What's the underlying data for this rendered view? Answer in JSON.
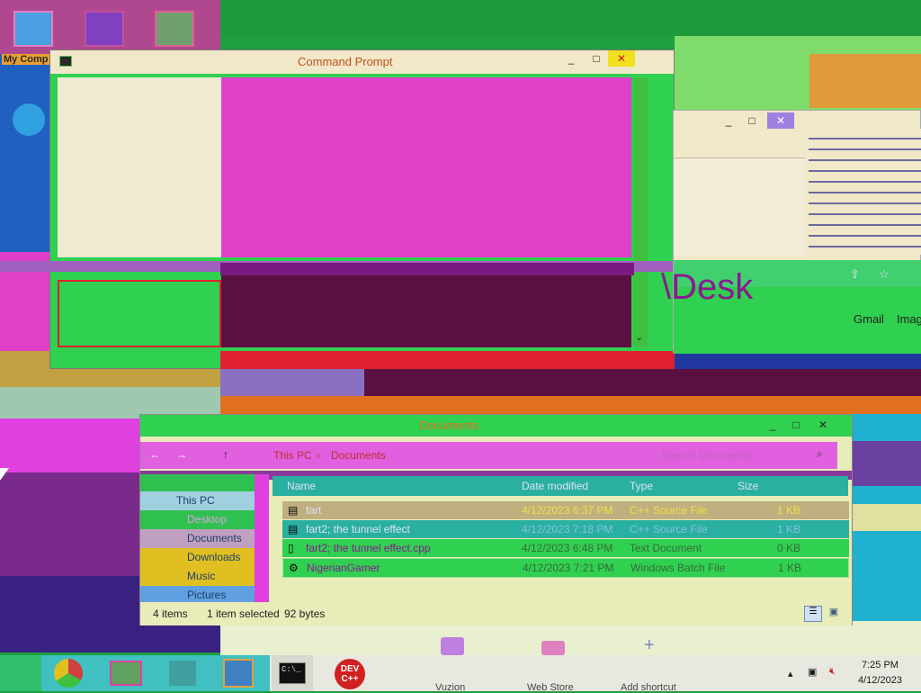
{
  "desktop": {
    "icon_label_partial": "My Comp",
    "path_fragment": "\\Desk",
    "gmail_link": "Gmail",
    "images_link": "Imag",
    "shortcuts": [
      {
        "label": "Vuzion"
      },
      {
        "label": "Web Store"
      },
      {
        "label": "Add shortcut"
      }
    ]
  },
  "cmd_window": {
    "title": "Command Prompt",
    "controls": {
      "minimize": "_",
      "maximize": "□",
      "close": "✕"
    }
  },
  "second_window": {
    "controls": {
      "minimize": "_",
      "maximize": "□",
      "close": "✕"
    }
  },
  "explorer": {
    "title": "Documents",
    "breadcrumb": [
      "This PC",
      "Documents"
    ],
    "search_placeholder": "Search Documents",
    "nav_items": [
      {
        "label": "This PC",
        "icon": "computer-icon"
      },
      {
        "label": "Desktop",
        "icon": "desktop-icon"
      },
      {
        "label": "Documents",
        "icon": "documents-icon"
      },
      {
        "label": "Downloads",
        "icon": "downloads-icon"
      },
      {
        "label": "Music",
        "icon": "music-icon"
      },
      {
        "label": "Pictures",
        "icon": "pictures-icon"
      }
    ],
    "columns": [
      "Name",
      "Date modified",
      "Type",
      "Size"
    ],
    "files": [
      {
        "name": "fart",
        "date": "4/12/2023 6:37 PM",
        "type": "C++ Source File",
        "size": "1 KB"
      },
      {
        "name": "fart2; the tunnel effect",
        "date": "4/12/2023 7:18 PM",
        "type": "C++ Source File",
        "size": "1 KB"
      },
      {
        "name": "fart2; the tunnel effect.cpp",
        "date": "4/12/2023 6:48 PM",
        "type": "Text Document",
        "size": "0 KB"
      },
      {
        "name": "NigerianGamer",
        "date": "4/12/2023 7:21 PM",
        "type": "Windows Batch File",
        "size": "1 KB"
      }
    ],
    "status": {
      "items": "4 items",
      "selected": "1 item selected",
      "size": "92 bytes"
    }
  },
  "taskbar": {
    "devcpp_label": "DEV\nC++",
    "clock_time": "7:25 PM",
    "clock_date": "4/12/2023"
  },
  "colors": {
    "magenta": "#e040c8",
    "green": "#2ecc40",
    "cream": "#f0e8c8",
    "dark_purple": "#5a1040",
    "red": "#e02030"
  }
}
